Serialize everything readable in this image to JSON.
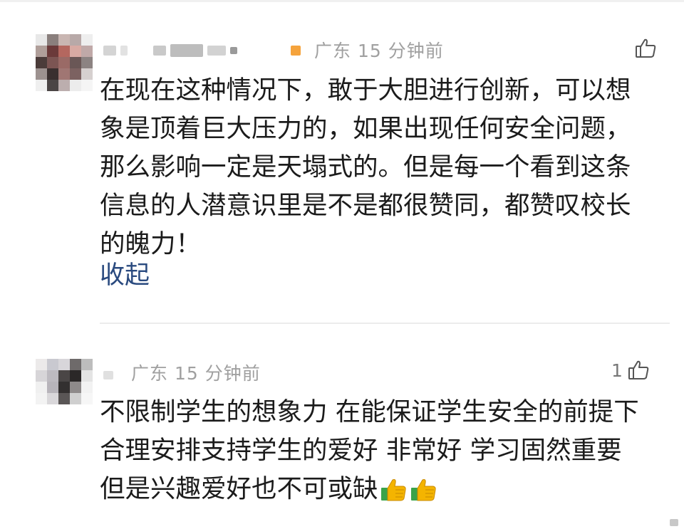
{
  "comments": [
    {
      "location": "广东",
      "time_ago": "15 分钟前",
      "like_count": "",
      "text_lines": [
        "在现在这种情况下，敢于大胆进行创新，可以想",
        "象是顶着巨大压力的，如果出现任何安全问题，",
        "那么影响一定是天塌式的。但是每一个看到这条",
        "信息的人潜意识里是不是都很赞同，都赞叹校长",
        "的魄力！"
      ],
      "collapse_label": "收起"
    },
    {
      "location": "广东",
      "time_ago": "15 分钟前",
      "like_count": "1",
      "text_lines": [
        "不限制学生的想象力 在能保证学生安全的前提下",
        "合理安排支持学生的爱好 非常好 学习固然重要",
        "但是兴趣爱好也不可或缺"
      ],
      "emojis": [
        "thumbs-up-icon",
        "thumbs-up-icon"
      ]
    }
  ],
  "colors": {
    "meta_gray": "#a0a0a0",
    "link_blue": "#2a4a7f",
    "badge_orange": "#f5a33c"
  }
}
